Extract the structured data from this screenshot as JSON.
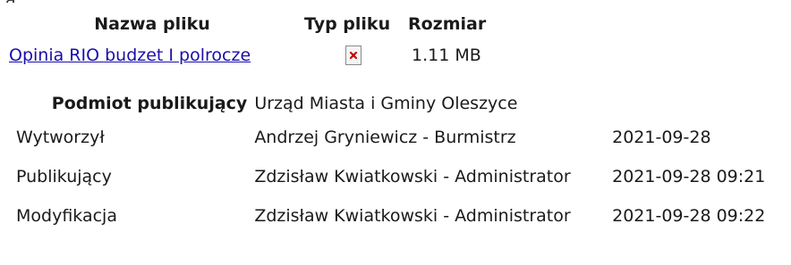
{
  "fragment": "ą",
  "files": {
    "headers": {
      "name": "Nazwa pliku",
      "type": "Typ pliku",
      "size": "Rozmiar"
    },
    "rows": [
      {
        "name": "Opinia RIO budzet I polrocze",
        "type_icon": "broken-image-icon",
        "size": "1.11 MB"
      }
    ]
  },
  "meta": {
    "publisher_label": "Podmiot publikujący",
    "publisher_value": "Urząd Miasta i Gminy Oleszyce",
    "rows": [
      {
        "label": "Wytworzył",
        "value": "Andrzej Gryniewicz - Burmistrz",
        "date": "2021-09-28"
      },
      {
        "label": "Publikujący",
        "value": "Zdzisław Kwiatkowski - Administrator",
        "date": "2021-09-28 09:21"
      },
      {
        "label": "Modyfikacja",
        "value": "Zdzisław Kwiatkowski - Administrator",
        "date": "2021-09-28 09:22"
      }
    ]
  },
  "colors": {
    "link": "#1a0dab",
    "icon_x": "#cc0000"
  }
}
